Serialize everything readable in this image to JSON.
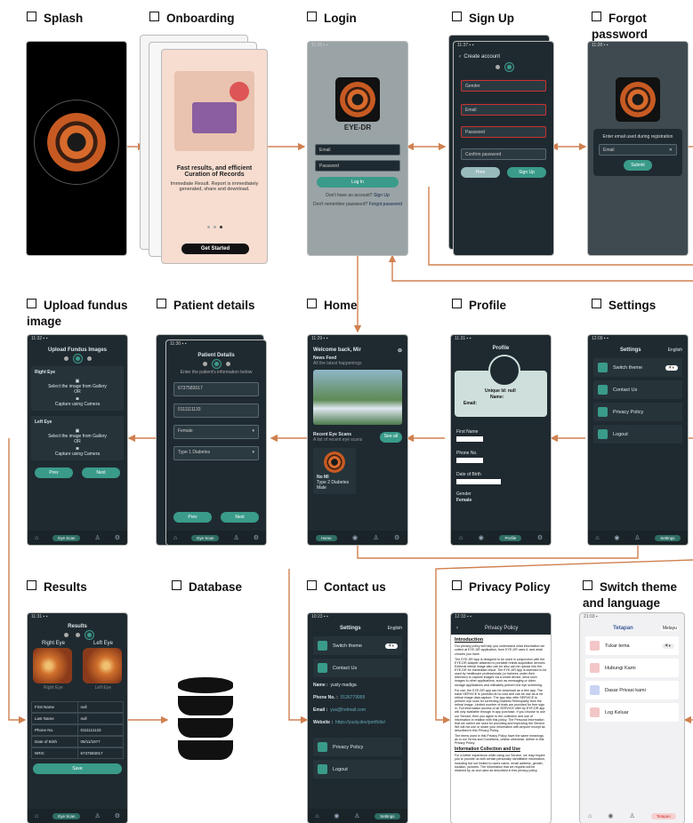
{
  "sections": {
    "splash": "Splash",
    "onboarding": "Onboarding",
    "login": "Login",
    "signup": "Sign Up",
    "forgot": "Forgot password",
    "upload": "Upload fundus image",
    "patient": "Patient details",
    "home": "Home",
    "profile": "Profile",
    "settings": "Settings",
    "results": "Results",
    "database": "Database",
    "contact": "Contact us",
    "privacy": "Privacy Policy",
    "theme": "Switch theme and language"
  },
  "onboarding": {
    "title": "Fast results, and efficient Curation of Records",
    "body": "Immediate Result. Report is immediately generated, share and download.",
    "cta": "Get Started"
  },
  "login": {
    "brand": "EYE-DR",
    "email": "Email",
    "password": "Password",
    "login_btn": "Log In",
    "no_account": "Don't have an account?",
    "signup_link": "Sign Up",
    "forgot_q": "Don't remember password?",
    "forgot_link": "Forgot password"
  },
  "signup": {
    "header": "Create account",
    "gender": "Gender",
    "email": "Email",
    "password": "Password",
    "confirm": "Confirm password",
    "prev": "Prev",
    "signup": "Sign Up"
  },
  "forgot": {
    "prompt": "Enter email used during registration",
    "email": "Email",
    "submit": "Submit"
  },
  "upload": {
    "header": "Upload Fundus Images",
    "right": "Right Eye",
    "left": "Left Eye",
    "gallery": "Select the image from Gallery",
    "or": "OR",
    "camera": "Capture using Camera",
    "prev": "Prev",
    "next": "Next",
    "nav_active": "Eye Scan"
  },
  "patient": {
    "header": "Patient Details",
    "hint": "Enter the patient's information below",
    "name": "6737583017",
    "phone": "0111111133",
    "gender": "Female",
    "type": "Type 1 Diabetes",
    "prev": "Prev",
    "next": "Next",
    "nav_active": "Eye Scan"
  },
  "home": {
    "welcome": "Welcome back,  Mir",
    "news": "News Feed",
    "news_sub": "All the latest happenings",
    "recent": "Recent Eye Scans",
    "recent_sub": "A list of recent eye scans",
    "see_all": "See all",
    "card_name": "No MI",
    "card_type": "Type 2 Diabetes",
    "card_status": "Male",
    "nav_active": "Home"
  },
  "profile": {
    "header": "Profile",
    "unique": "Unique Id:  null",
    "name": "Name:",
    "email": "Email:",
    "first": "First Name",
    "phone": "Phone No.",
    "dob": "Date of Birth",
    "gender_l": "Gender",
    "gender_v": "Female",
    "nav_active": "Profile"
  },
  "settings": {
    "header": "Settings",
    "lang": "English",
    "theme": "Switch theme",
    "contact": "Contact Us",
    "privacy": "Privacy Policy",
    "logout": "Logout",
    "nav_active": "Settings"
  },
  "results": {
    "header": "Results",
    "right": "Right Eye",
    "left": "Left Eye",
    "right_cap": "Right Eye",
    "left_cap": "Left Eye",
    "rows": [
      [
        "First Name",
        "null"
      ],
      [
        "Last Name",
        "null"
      ],
      [
        "Phone No.",
        "0111111133"
      ],
      [
        "Date of Birth",
        "05/11/1977"
      ],
      [
        "NRIC",
        "6737583017"
      ]
    ],
    "save": "Save",
    "nav_active": "Eye Scan"
  },
  "contact": {
    "header": "Settings",
    "lang": "English",
    "theme": "Switch theme",
    "contact": "Contact Us",
    "name_l": "Name :",
    "name_v": "yusly madiga",
    "phone_l": "Phone No. :",
    "phone_v": "0126779995",
    "email_l": "Email :",
    "email_v": "yus@hotmail.com",
    "web_l": "Website :",
    "web_v": "https://yusly.dev/portfolio/",
    "privacy": "Privacy Policy",
    "logout": "Logout",
    "nav_active": "Settings"
  },
  "privacy": {
    "header": "Privacy Policy",
    "h1": "Introduction",
    "p1": "Our privacy policy will help you understand what information we collect at EYE-DR application, from EYE-DR uses it, and what choices you have.",
    "p2": "The EYE-DR App is designed to be used in conjunction with the EYE-DR adapter attached to portable retinal acquisition devices. External retinal image also can be also can be upload into the EYE-DR for immediate result. The EYE-DR App is intended to be used by healthcare professionals (or trainees under their direction) to capture images via a smart device, send such images to other applications, such as messaging or video storage applications and ultimately perform the eye screening.",
    "p3": "For use, the EYE-DR app can be download as a free app. The basic SERVICE is provided at no cost and can be use as-is for retinal image data capture. The app also offer SERVICE to perform eye scan for screening Diabetic Retinopathy from the retinal image. Limited number of trials are provided for free sign in. Full information access of all SERVICE offer by EYE-DR app will only available through in app purchase. If you choose to use our Service, then you agree to the collection and use of information in relation with this policy. The Personal Information that we collect are used for providing and improving the Service. We will not use or share your information with anyone except as described in this Privacy Policy.",
    "p4": "The terms used in this Privacy Policy have the same meanings as in our Terms and Conditions, unless otherwise, define in this Privacy Policy.",
    "h2": "Information Collection and Use",
    "p5": "For a better experience while using our Service, we may require you to provide us with certain personally identifiable information, including but not limited to users name, email address, gender, location, pictures. The information that we request will be retained by us and used as described in this privacy policy."
  },
  "theme": {
    "header": "Tetapan",
    "lang": "Melayu",
    "theme": "Tukar tema",
    "contact": "Hubungi Kami",
    "privacy": "Dasar Privasi kami",
    "logout": "Log Keluar",
    "nav_active": "Tetapan"
  }
}
